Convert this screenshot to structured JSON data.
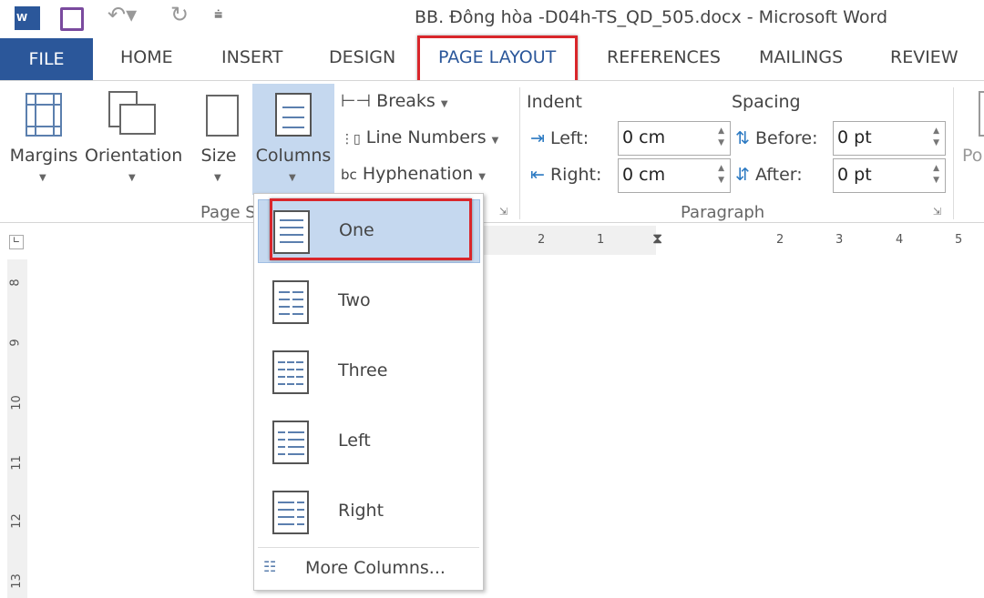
{
  "window": {
    "title": "BB. Đông hòa -D04h-TS_QD_505.docx - Microsoft Word"
  },
  "qat": {
    "word": "word-logo-icon",
    "save": "save-icon",
    "undo": "undo-icon",
    "redo": "redo-icon",
    "customize": "customize-icon"
  },
  "tabs": [
    "FILE",
    "HOME",
    "INSERT",
    "DESIGN",
    "PAGE LAYOUT",
    "REFERENCES",
    "MAILINGS",
    "REVIEW"
  ],
  "ribbon": {
    "margins": "Margins",
    "orientation": "Orientation",
    "size": "Size",
    "columns": "Columns",
    "breaks": "Breaks",
    "line_numbers": "Line Numbers",
    "hyphenation": "Hyphenation",
    "page_setup": "Page S",
    "indent": "Indent",
    "spacing": "Spacing",
    "left": "Left:",
    "right": "Right:",
    "before": "Before:",
    "after": "After:",
    "left_val": "0 cm",
    "right_val": "0 cm",
    "before_val": "0 pt",
    "after_val": "0 pt",
    "paragraph": "Paragraph",
    "position": "Po"
  },
  "ruler": {
    "h_left": [
      "2",
      "1"
    ],
    "h_right": [
      "2",
      "3",
      "4",
      "5"
    ],
    "v": [
      "8",
      "9",
      "10",
      "11",
      "12",
      "13"
    ]
  },
  "columns_menu": {
    "items": [
      "One",
      "Two",
      "Three",
      "Left",
      "Right"
    ],
    "selected": "One",
    "more": "More Columns..."
  },
  "accent": "#2b579a",
  "highlight": "#d9262b"
}
